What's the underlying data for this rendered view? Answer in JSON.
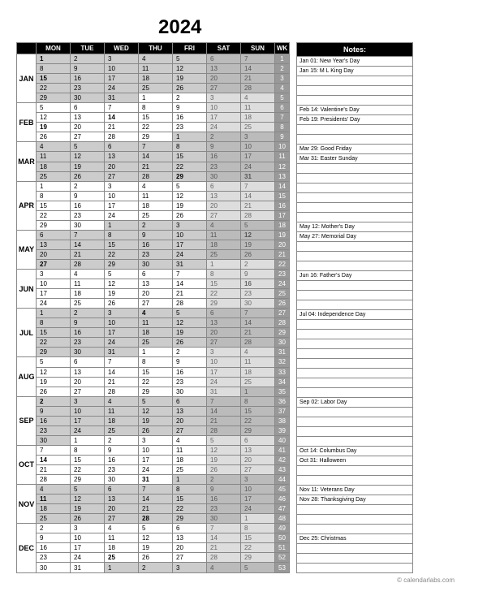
{
  "year": "2024",
  "footer": "© calendarlabs.com",
  "weekday_headers": [
    "MON",
    "TUE",
    "WED",
    "THU",
    "FRI",
    "SAT",
    "SUN",
    "WK"
  ],
  "notes_header": "Notes:",
  "months": [
    {
      "label": "JAN",
      "shade": true,
      "rows": [
        {
          "wk": 1,
          "bold": [
            1
          ],
          "d": [
            1,
            2,
            3,
            4,
            5,
            6,
            7
          ]
        },
        {
          "wk": 2,
          "d": [
            8,
            9,
            10,
            11,
            12,
            13,
            14
          ]
        },
        {
          "wk": 3,
          "bold": [
            15
          ],
          "d": [
            15,
            16,
            17,
            18,
            19,
            20,
            21
          ]
        },
        {
          "wk": 4,
          "d": [
            22,
            23,
            24,
            25,
            26,
            27,
            28
          ]
        },
        {
          "wk": 5,
          "d": [
            29,
            30,
            31,
            1,
            2,
            3,
            4
          ],
          "next_from": 4
        }
      ]
    },
    {
      "label": "FEB",
      "shade": false,
      "rows": [
        {
          "wk": 6,
          "d": [
            5,
            6,
            7,
            8,
            9,
            10,
            11
          ]
        },
        {
          "wk": 7,
          "bold": [
            14
          ],
          "d": [
            12,
            13,
            14,
            15,
            16,
            17,
            18
          ]
        },
        {
          "wk": 8,
          "bold": [
            19
          ],
          "d": [
            19,
            20,
            21,
            22,
            23,
            24,
            25
          ]
        },
        {
          "wk": 9,
          "d": [
            26,
            27,
            28,
            29,
            1,
            2,
            3
          ],
          "next_from": 5
        }
      ]
    },
    {
      "label": "MAR",
      "shade": true,
      "rows": [
        {
          "wk": 10,
          "d": [
            4,
            5,
            6,
            7,
            8,
            9,
            10
          ]
        },
        {
          "wk": 11,
          "d": [
            11,
            12,
            13,
            14,
            15,
            16,
            17
          ]
        },
        {
          "wk": 12,
          "d": [
            18,
            19,
            20,
            21,
            22,
            23,
            24
          ]
        },
        {
          "wk": 13,
          "bold": [
            29,
            31
          ],
          "d": [
            25,
            26,
            27,
            28,
            29,
            30,
            31
          ]
        }
      ]
    },
    {
      "label": "APR",
      "shade": false,
      "rows": [
        {
          "wk": 14,
          "d": [
            1,
            2,
            3,
            4,
            5,
            6,
            7
          ]
        },
        {
          "wk": 15,
          "d": [
            8,
            9,
            10,
            11,
            12,
            13,
            14
          ]
        },
        {
          "wk": 16,
          "d": [
            15,
            16,
            17,
            18,
            19,
            20,
            21
          ]
        },
        {
          "wk": 17,
          "d": [
            22,
            23,
            24,
            25,
            26,
            27,
            28
          ]
        },
        {
          "wk": 18,
          "d": [
            29,
            30,
            1,
            2,
            3,
            4,
            5
          ],
          "next_from": 3
        }
      ]
    },
    {
      "label": "MAY",
      "shade": true,
      "rows": [
        {
          "wk": 19,
          "bold": [
            12
          ],
          "d": [
            6,
            7,
            8,
            9,
            10,
            11,
            12
          ]
        },
        {
          "wk": 20,
          "d": [
            13,
            14,
            15,
            16,
            17,
            18,
            19
          ]
        },
        {
          "wk": 21,
          "d": [
            20,
            21,
            22,
            23,
            24,
            25,
            26
          ]
        },
        {
          "wk": 22,
          "bold": [
            27
          ],
          "d": [
            27,
            28,
            29,
            30,
            31,
            1,
            2
          ],
          "next_from": 6
        }
      ]
    },
    {
      "label": "JUN",
      "shade": false,
      "rows": [
        {
          "wk": 23,
          "d": [
            3,
            4,
            5,
            6,
            7,
            8,
            9
          ]
        },
        {
          "wk": 24,
          "bold": [
            16
          ],
          "d": [
            10,
            11,
            12,
            13,
            14,
            15,
            16
          ]
        },
        {
          "wk": 25,
          "d": [
            17,
            18,
            19,
            20,
            21,
            22,
            23
          ]
        },
        {
          "wk": 26,
          "d": [
            24,
            25,
            26,
            27,
            28,
            29,
            30
          ]
        }
      ]
    },
    {
      "label": "JUL",
      "shade": true,
      "rows": [
        {
          "wk": 27,
          "bold": [
            4
          ],
          "d": [
            1,
            2,
            3,
            4,
            5,
            6,
            7
          ]
        },
        {
          "wk": 28,
          "d": [
            8,
            9,
            10,
            11,
            12,
            13,
            14
          ]
        },
        {
          "wk": 29,
          "d": [
            15,
            16,
            17,
            18,
            19,
            20,
            21
          ]
        },
        {
          "wk": 30,
          "d": [
            22,
            23,
            24,
            25,
            26,
            27,
            28
          ]
        },
        {
          "wk": 31,
          "d": [
            29,
            30,
            31,
            1,
            2,
            3,
            4
          ],
          "next_from": 4
        }
      ]
    },
    {
      "label": "AUG",
      "shade": false,
      "rows": [
        {
          "wk": 32,
          "d": [
            5,
            6,
            7,
            8,
            9,
            10,
            11
          ]
        },
        {
          "wk": 33,
          "d": [
            12,
            13,
            14,
            15,
            16,
            17,
            18
          ]
        },
        {
          "wk": 34,
          "d": [
            19,
            20,
            21,
            22,
            23,
            24,
            25
          ]
        },
        {
          "wk": 35,
          "d": [
            26,
            27,
            28,
            29,
            30,
            31,
            1
          ],
          "next_from": 7
        }
      ]
    },
    {
      "label": "SEP",
      "shade": true,
      "rows": [
        {
          "wk": 36,
          "bold": [
            2
          ],
          "d": [
            2,
            3,
            4,
            5,
            6,
            7,
            8
          ]
        },
        {
          "wk": 37,
          "d": [
            9,
            10,
            11,
            12,
            13,
            14,
            15
          ]
        },
        {
          "wk": 38,
          "d": [
            16,
            17,
            18,
            19,
            20,
            21,
            22
          ]
        },
        {
          "wk": 39,
          "d": [
            23,
            24,
            25,
            26,
            27,
            28,
            29
          ]
        },
        {
          "wk": 40,
          "d": [
            30,
            1,
            2,
            3,
            4,
            5,
            6
          ],
          "next_from": 2
        }
      ]
    },
    {
      "label": "OCT",
      "shade": false,
      "rows": [
        {
          "wk": 41,
          "d": [
            7,
            8,
            9,
            10,
            11,
            12,
            13
          ]
        },
        {
          "wk": 42,
          "bold": [
            14
          ],
          "d": [
            14,
            15,
            16,
            17,
            18,
            19,
            20
          ]
        },
        {
          "wk": 43,
          "d": [
            21,
            22,
            23,
            24,
            25,
            26,
            27
          ]
        },
        {
          "wk": 44,
          "bold": [
            31
          ],
          "d": [
            28,
            29,
            30,
            31,
            1,
            2,
            3
          ],
          "next_from": 5
        }
      ]
    },
    {
      "label": "NOV",
      "shade": true,
      "rows": [
        {
          "wk": 45,
          "bold": [
            11
          ],
          "d": [
            4,
            5,
            6,
            7,
            8,
            9,
            10
          ]
        },
        {
          "wk": 46,
          "bold": [
            11
          ],
          "d": [
            11,
            12,
            13,
            14,
            15,
            16,
            17
          ]
        },
        {
          "wk": 47,
          "d": [
            18,
            19,
            20,
            21,
            22,
            23,
            24
          ]
        },
        {
          "wk": 48,
          "bold": [
            28
          ],
          "d": [
            25,
            26,
            27,
            28,
            29,
            30,
            1
          ],
          "next_from": 7
        }
      ]
    },
    {
      "label": "DEC",
      "shade": false,
      "rows": [
        {
          "wk": 49,
          "d": [
            2,
            3,
            4,
            5,
            6,
            7,
            8
          ]
        },
        {
          "wk": 50,
          "d": [
            9,
            10,
            11,
            12,
            13,
            14,
            15
          ]
        },
        {
          "wk": 51,
          "d": [
            16,
            17,
            18,
            19,
            20,
            21,
            22
          ]
        },
        {
          "wk": 52,
          "bold": [
            25
          ],
          "d": [
            23,
            24,
            25,
            26,
            27,
            28,
            29
          ]
        },
        {
          "wk": 53,
          "d": [
            30,
            31,
            1,
            2,
            3,
            4,
            5
          ],
          "next_from": 3
        }
      ]
    }
  ],
  "notes": [
    {
      "row": 0,
      "text": "Jan 01: New Year's Day"
    },
    {
      "row": 1,
      "text": "Jan 15: M L King Day"
    },
    {
      "row": 5,
      "text": "Feb 14: Valentine's Day"
    },
    {
      "row": 6,
      "text": "Feb 19: Presidents' Day"
    },
    {
      "row": 9,
      "text": "Mar 29: Good Friday"
    },
    {
      "row": 10,
      "text": "Mar 31: Easter Sunday"
    },
    {
      "row": 17,
      "text": "May 12: Mother's Day"
    },
    {
      "row": 18,
      "text": "May 27: Memorial Day"
    },
    {
      "row": 22,
      "text": "Jun 16: Father's Day"
    },
    {
      "row": 26,
      "text": "Jul 04: Independence Day"
    },
    {
      "row": 35,
      "text": "Sep 02: Labor Day"
    },
    {
      "row": 40,
      "text": "Oct 14: Columbus Day"
    },
    {
      "row": 41,
      "text": "Oct 31: Halloween"
    },
    {
      "row": 44,
      "text": "Nov 11: Veterans Day"
    },
    {
      "row": 45,
      "text": "Nov 28: Thanksgiving Day"
    },
    {
      "row": 49,
      "text": "Dec 25: Christmas"
    }
  ]
}
